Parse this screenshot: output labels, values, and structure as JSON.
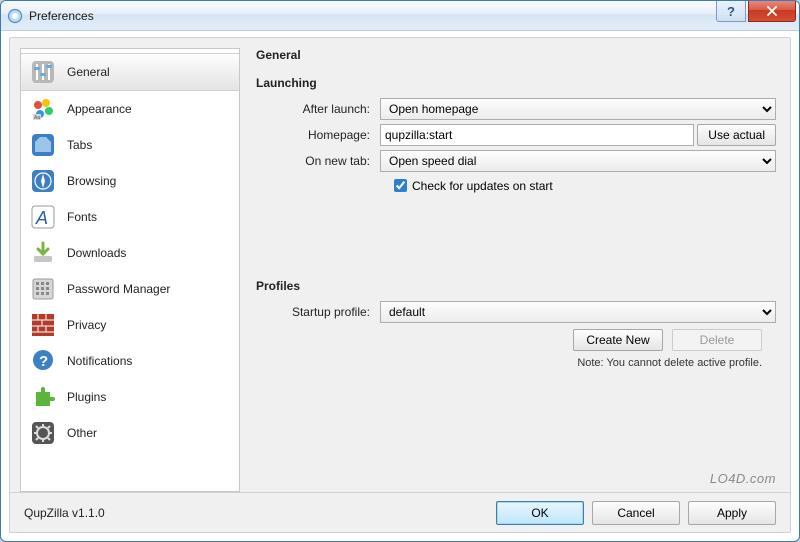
{
  "window": {
    "title": "Preferences"
  },
  "sidebar": {
    "items": [
      {
        "label": "General"
      },
      {
        "label": "Appearance"
      },
      {
        "label": "Tabs"
      },
      {
        "label": "Browsing"
      },
      {
        "label": "Fonts"
      },
      {
        "label": "Downloads"
      },
      {
        "label": "Password Manager"
      },
      {
        "label": "Privacy"
      },
      {
        "label": "Notifications"
      },
      {
        "label": "Plugins"
      },
      {
        "label": "Other"
      }
    ]
  },
  "main": {
    "heading": "General",
    "launching": {
      "title": "Launching",
      "after_launch_label": "After launch:",
      "after_launch_value": "Open homepage",
      "homepage_label": "Homepage:",
      "homepage_value": "qupzilla:start",
      "use_actual_label": "Use actual",
      "on_new_tab_label": "On new tab:",
      "on_new_tab_value": "Open speed dial",
      "check_updates_label": "Check for updates on start",
      "check_updates_checked": true
    },
    "profiles": {
      "title": "Profiles",
      "startup_label": "Startup profile:",
      "startup_value": "default",
      "create_new_label": "Create New",
      "delete_label": "Delete",
      "note": "Note: You cannot delete active profile."
    }
  },
  "footer": {
    "version": "QupZilla v1.1.0",
    "ok": "OK",
    "cancel": "Cancel",
    "apply": "Apply"
  },
  "watermark": "LO4D.com"
}
